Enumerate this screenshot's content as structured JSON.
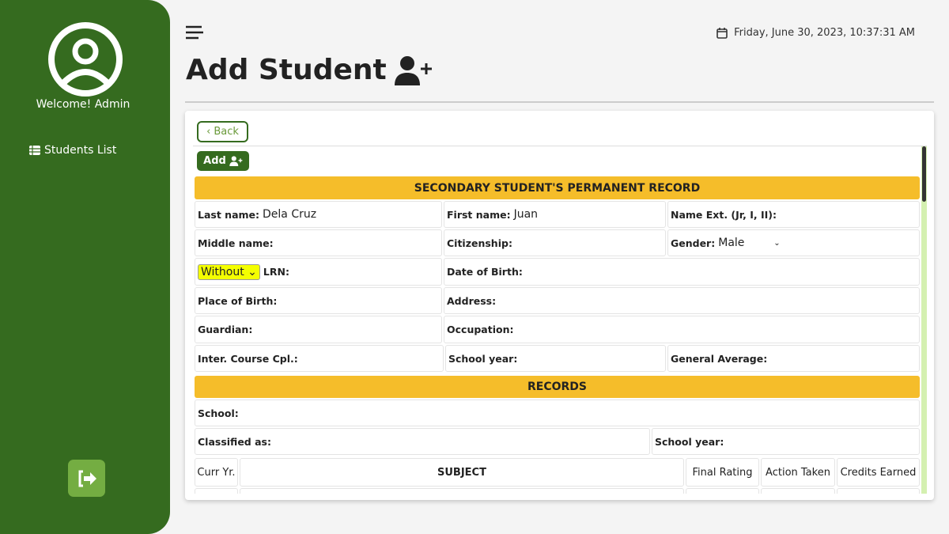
{
  "sidebar": {
    "welcome": "Welcome! Admin",
    "items": [
      {
        "label": "Students List",
        "icon": "table-list-icon"
      }
    ],
    "logout_icon": "logout-icon"
  },
  "header": {
    "datetime": "Friday, June 30, 2023, 10:37:31 AM",
    "title": "Add Student"
  },
  "form": {
    "back": "Back",
    "add": "Add",
    "section1": "SECONDARY STUDENT'S PERMANENT RECORD",
    "last_name_label": "Last name:",
    "last_name": "Dela Cruz",
    "first_name_label": "First name:",
    "first_name": "Juan",
    "name_ext_label": "Name Ext. (Jr, I, II):",
    "middle_name_label": "Middle name:",
    "citizenship_label": "Citizenship:",
    "gender_label": "Gender:",
    "gender": "Male",
    "lrn_option": "Without",
    "lrn_label": "LRN:",
    "dob_label": "Date of Birth:",
    "pob_label": "Place of Birth:",
    "address_label": "Address:",
    "guardian_label": "Guardian:",
    "occupation_label": "Occupation:",
    "course_label": "Inter. Course Cpl.:",
    "school_year_label": "School year:",
    "gen_avg_label": "General Average:",
    "section2": "RECORDS",
    "school_label": "School:",
    "classified_label": "Classified as:",
    "school_year2_label": "School year:",
    "table_headers": [
      "Curr Yr.",
      "SUBJECT",
      "Final Rating",
      "Action Taken",
      "Credits Earned"
    ]
  },
  "colors": {
    "sidebar": "#356b1f",
    "band": "#f5bd2a",
    "logout": "#74ad42"
  }
}
